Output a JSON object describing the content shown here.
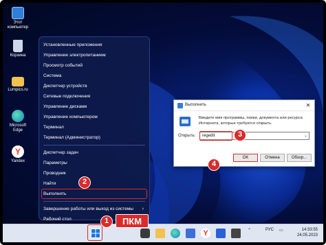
{
  "desktop": {
    "icons": [
      {
        "label_lines": [
          "Этот",
          "компьютер"
        ],
        "icon": "computer-icon",
        "color": "#2f7fd8"
      },
      {
        "label_lines": [
          "Корзина"
        ],
        "icon": "recycle-bin-icon",
        "color": "#cfd8e8"
      },
      {
        "label_lines": [
          "Lumpics.ru"
        ],
        "icon": "folder-icon",
        "color": "#f2c14e"
      },
      {
        "label_lines": [
          "Microsoft",
          "Edge"
        ],
        "icon": "edge-icon",
        "color": "#1fa88f"
      },
      {
        "label_lines": [
          "Yandex"
        ],
        "icon": "yandex-icon",
        "color": "#ff3333"
      }
    ]
  },
  "winx_menu": {
    "items": [
      {
        "label": "Установленные приложения"
      },
      {
        "label": "Управление электропитанием"
      },
      {
        "label": "Просмотр событий"
      },
      {
        "label": "Система"
      },
      {
        "label": "Диспетчер устройств"
      },
      {
        "label": "Сетевые подключения"
      },
      {
        "label": "Управление дисками"
      },
      {
        "label": "Управление компьютером"
      },
      {
        "label": "Терминал"
      },
      {
        "label": "Терминал (Администратор)"
      },
      {
        "sep": true
      },
      {
        "label": "Диспетчер задач"
      },
      {
        "label": "Параметры"
      },
      {
        "label": "Проводник"
      },
      {
        "label": "Найти"
      },
      {
        "label": "Выполнить",
        "active": true
      },
      {
        "sep": true
      },
      {
        "label": "Завершение работы или выход из системы",
        "submenu": true
      },
      {
        "label": "Рабочий стол"
      }
    ],
    "chevron": "›"
  },
  "run_dialog": {
    "title": "Выполнить",
    "close": "✕",
    "description": "Введите имя программы, папки, документа или ресурса Интернета, которые требуется открыть.",
    "open_label": "Открыть:",
    "open_value": "regedit",
    "dropdown": "⌄",
    "ok": "OK",
    "cancel": "Отмена",
    "browse": "Обзор..."
  },
  "taskbar": {
    "lang": "РУС",
    "time": "14:33:55",
    "date": "24.05.2023"
  },
  "annotations": {
    "step1": "1",
    "step2": "2",
    "step3": "3",
    "step4": "4",
    "pkm": "ПКМ"
  },
  "colors": {
    "accent_red": "#d92b2b",
    "wallpaper": "#061a66",
    "menu_bg": "#0c1a4a"
  }
}
